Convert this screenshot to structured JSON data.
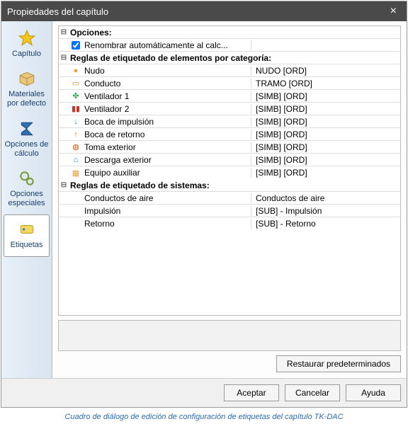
{
  "title": "Propiedades del capítulo",
  "sidebar": [
    {
      "label": "Capítulo"
    },
    {
      "label": "Materiales por defecto"
    },
    {
      "label": "Opciones de cálculo"
    },
    {
      "label": "Opciones especiales"
    },
    {
      "label": "Etiquetas"
    }
  ],
  "sections": {
    "opciones": {
      "title": "Opciones:",
      "rename": {
        "label": "Renombrar automáticamente al calc...",
        "checked": true
      }
    },
    "categoria": {
      "title": "Reglas de etiquetado de elementos por categoría:",
      "rows": [
        {
          "icon": "●",
          "color": "#e6a23c",
          "name": "Nudo",
          "value": "NUDO [ORD]"
        },
        {
          "icon": "▭",
          "color": "#d08830",
          "name": "Conducto",
          "value": "TRAMO [ORD]"
        },
        {
          "icon": "✤",
          "color": "#3aa655",
          "name": "Ventilador 1",
          "value": "[SIMB] [ORD]"
        },
        {
          "icon": "▮▮",
          "color": "#c0392b",
          "name": "Ventilador 2",
          "value": "[SIMB] [ORD]"
        },
        {
          "icon": "↓",
          "color": "#2a7bd6",
          "name": "Boca de impulsión",
          "value": "[SIMB] [ORD]"
        },
        {
          "icon": "↑",
          "color": "#e67e22",
          "name": "Boca de retorno",
          "value": "[SIMB] [ORD]"
        },
        {
          "icon": "◍",
          "color": "#d35400",
          "name": "Toma exterior",
          "value": "[SIMB] [ORD]"
        },
        {
          "icon": "⌂",
          "color": "#2a7bd6",
          "name": "Descarga exterior",
          "value": "[SIMB] [ORD]"
        },
        {
          "icon": "▦",
          "color": "#e6a23c",
          "name": "Equipo auxiliar",
          "value": "[SIMB] [ORD]"
        }
      ]
    },
    "sistemas": {
      "title": "Reglas de etiquetado de sistemas:",
      "rows": [
        {
          "name": "Conductos de aire",
          "value": "Conductos de aire"
        },
        {
          "name": "Impulsión",
          "value": "[SUB] - Impulsión"
        },
        {
          "name": "Retorno",
          "value": "[SUB] - Retorno"
        }
      ]
    }
  },
  "buttons": {
    "restore": "Restaurar predeterminados",
    "ok": "Aceptar",
    "cancel": "Cancelar",
    "help": "Ayuda"
  },
  "caption": "Cuadro de diálogo de edición de configuración de etiquetas del capítulo TK-DAC"
}
